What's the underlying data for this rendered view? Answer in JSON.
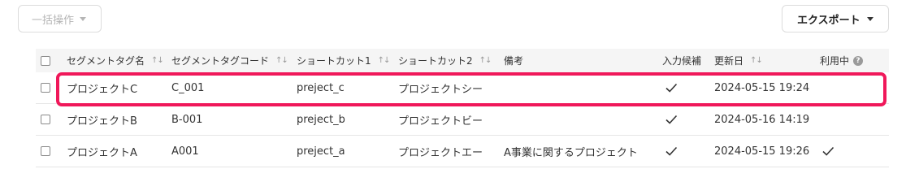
{
  "toolbar": {
    "bulk_action_label": "一括操作",
    "export_label": "エクスポート"
  },
  "table": {
    "headers": {
      "tag_name": "セグメントタグ名",
      "tag_code": "セグメントタグコード",
      "shortcut1": "ショートカット1",
      "shortcut2": "ショートカット2",
      "note": "備考",
      "input_candidate": "入力候補",
      "updated": "更新日",
      "in_use": "利用中"
    },
    "rows": [
      {
        "name": "プロジェクトC",
        "code": "C_001",
        "shortcut1": "preject_c",
        "shortcut2": "プロジェクトシー",
        "note": "",
        "input_candidate": true,
        "updated": "2024-05-15 19:24",
        "in_use": false
      },
      {
        "name": "プロジェクトB",
        "code": "B-001",
        "shortcut1": "preject_b",
        "shortcut2": "プロジェクトビー",
        "note": "",
        "input_candidate": true,
        "updated": "2024-05-16 14:19",
        "in_use": false
      },
      {
        "name": "プロジェクトA",
        "code": "A001",
        "shortcut1": "preject_a",
        "shortcut2": "プロジェクトエー",
        "note": "A事業に関するプロジェクト",
        "input_candidate": true,
        "updated": "2024-05-15 19:26",
        "in_use": true
      }
    ]
  },
  "colors": {
    "highlight": "#f0185a",
    "header_bg": "#f5f5f5"
  }
}
